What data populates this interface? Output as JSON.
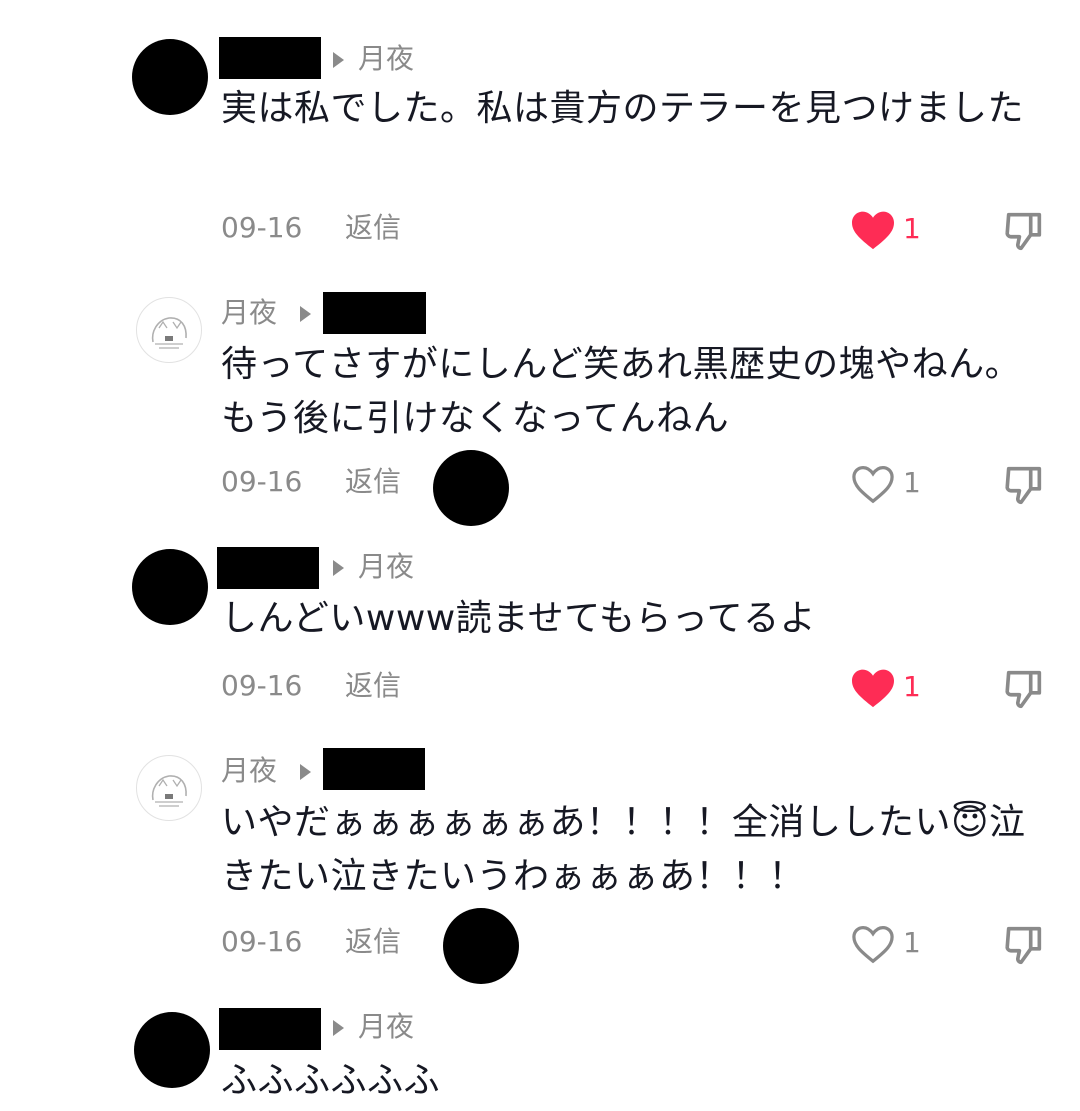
{
  "comments": [
    {
      "reply_target": "月夜",
      "text": "実は私でした。私は貴方のテラーを見つけました",
      "date": "09-16",
      "reply_label": "返信",
      "likes": "1",
      "liked": true
    },
    {
      "author": "月夜",
      "text": "待ってさすがにしんど笑あれ黒歴史の塊やねん。もう後に引けなくなってんねん",
      "date": "09-16",
      "reply_label": "返信",
      "likes": "1",
      "liked": false
    },
    {
      "reply_target": "月夜",
      "text": "しんどいwww読ませてもらってるよ",
      "date": "09-16",
      "reply_label": "返信",
      "likes": "1",
      "liked": true
    },
    {
      "author": "月夜",
      "text": "いやだぁぁぁぁぁぁあ！！！！全消ししたい😇泣きたい泣きたいうわぁぁぁあ！！！",
      "date": "09-16",
      "reply_label": "返信",
      "likes": "1",
      "liked": false
    },
    {
      "reply_target": "月夜",
      "text": "ふふふふふふ"
    }
  ],
  "colors": {
    "like_active": "#fe2c55",
    "muted": "#8a8a8a",
    "text": "#161823"
  },
  "icons": {
    "heart": "heart-icon",
    "dislike": "thumbs-down-icon",
    "reply_arrow": "play-arrow-icon"
  }
}
